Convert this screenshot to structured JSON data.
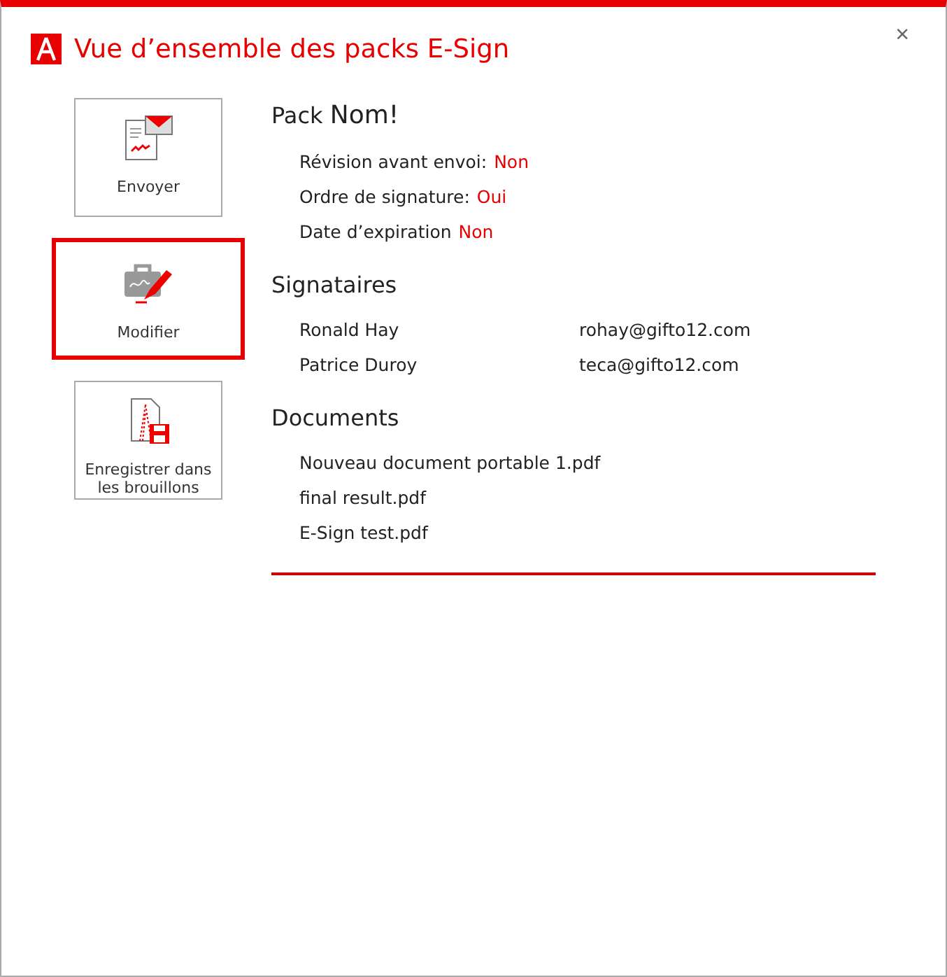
{
  "window": {
    "title": "Vue d’ensemble des packs E-Sign",
    "close": "×"
  },
  "actions": [
    {
      "kind": "send",
      "label": "Envoyer",
      "selected": false
    },
    {
      "kind": "edit",
      "label": "Modifier",
      "selected": true
    },
    {
      "kind": "save",
      "label": "Enregistrer dans les brouillons",
      "selected": false
    }
  ],
  "pack": {
    "label": "Pack",
    "name": "Nom!"
  },
  "properties": [
    {
      "label": "Révision avant envoi:",
      "value": "Non"
    },
    {
      "label": "Ordre de signature:",
      "value": "Oui"
    },
    {
      "label": "Date d’expiration",
      "value": "Non"
    }
  ],
  "signers_heading": "Signataires",
  "signers": [
    {
      "name": "Ronald Hay",
      "email": "rohay@gifto12.com"
    },
    {
      "name": "Patrice Duroy",
      "email": "teca@gifto12.com"
    }
  ],
  "documents_heading": "Documents",
  "documents": [
    "Nouveau document portable 1.pdf",
    "final result.pdf",
    "E-Sign test.pdf"
  ]
}
